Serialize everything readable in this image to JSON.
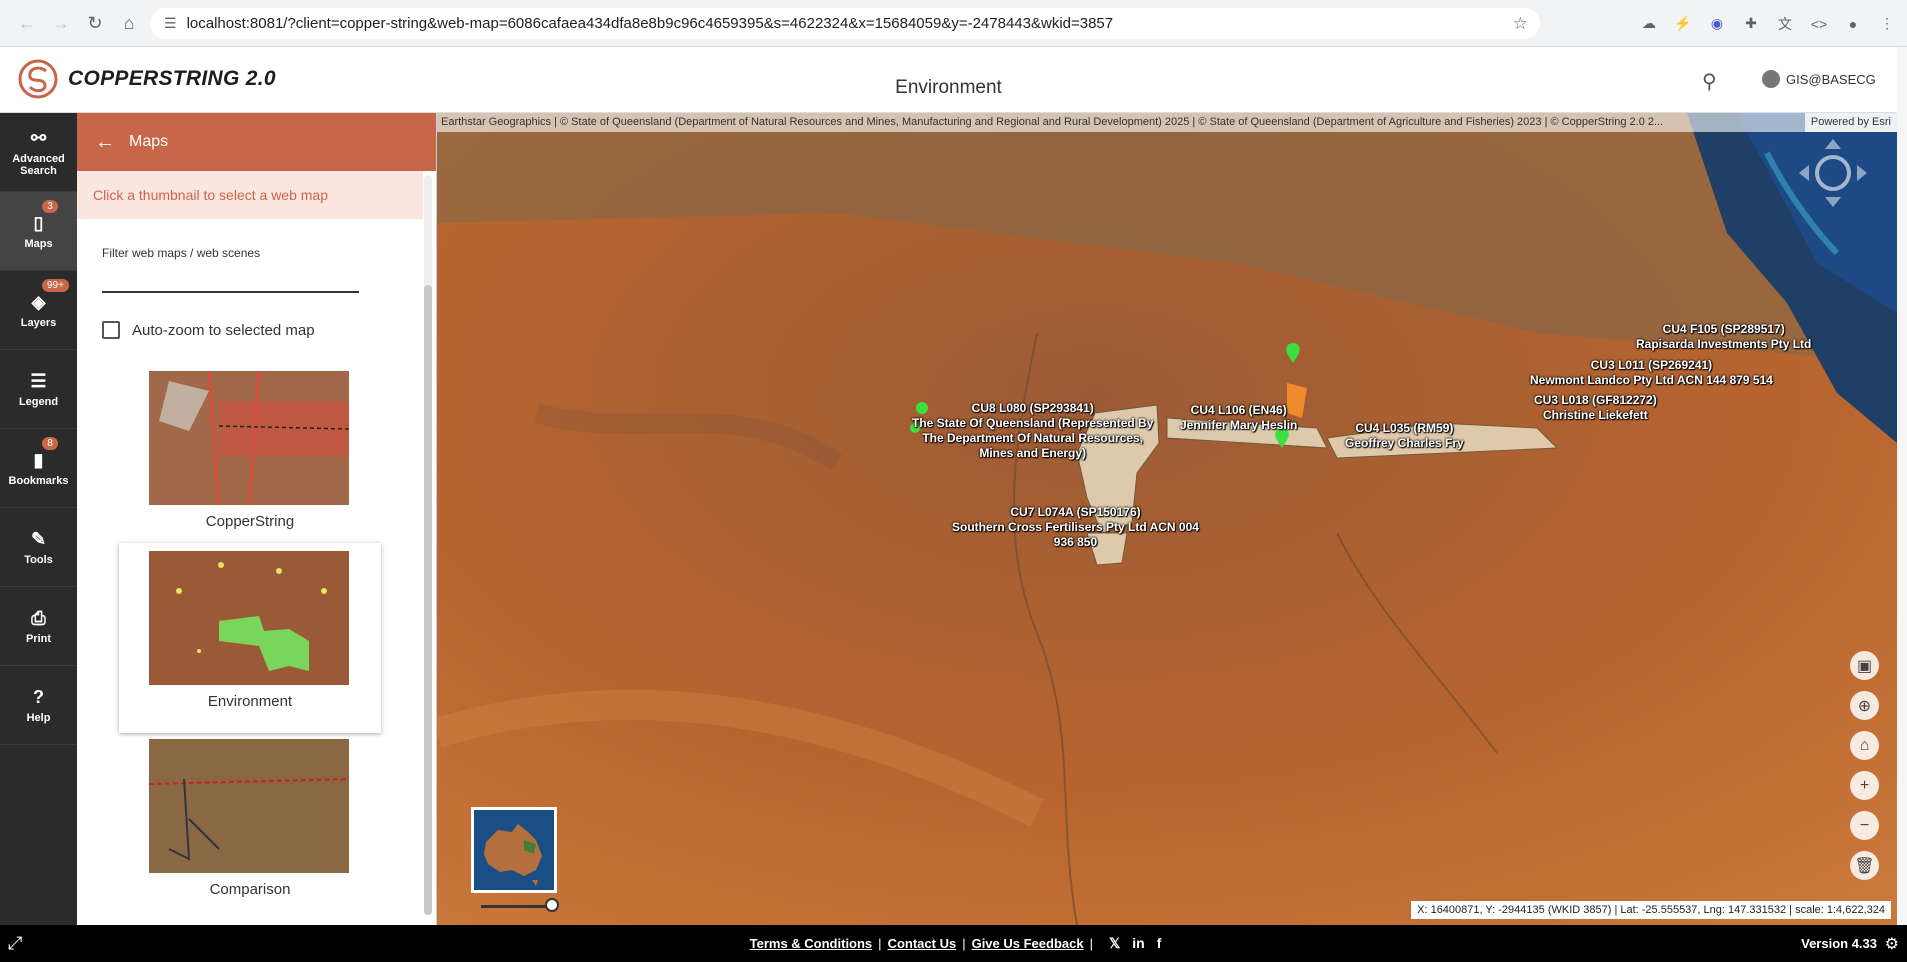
{
  "browser": {
    "url": "localhost:8081/?client=copper-string&web-map=6086cafaea434dfa8e8b9c96c4659395&s=4622324&x=15684059&y=-2478443&wkid=3857"
  },
  "header": {
    "logo_text": "COPPERSTRING 2.0",
    "title": "Environment",
    "user": "GIS@BASECG"
  },
  "rail": {
    "items": [
      {
        "label": "Advanced Search",
        "icon": "binoculars-icon",
        "badge": ""
      },
      {
        "label": "Maps",
        "icon": "map-icon",
        "badge": "3"
      },
      {
        "label": "Layers",
        "icon": "layers-icon",
        "badge": "99+"
      },
      {
        "label": "Legend",
        "icon": "list-icon",
        "badge": ""
      },
      {
        "label": "Bookmarks",
        "icon": "bookmark-icon",
        "badge": "8"
      },
      {
        "label": "Tools",
        "icon": "wrench-icon",
        "badge": ""
      },
      {
        "label": "Print",
        "icon": "printer-icon",
        "badge": ""
      },
      {
        "label": "Help",
        "icon": "help-icon",
        "badge": ""
      }
    ]
  },
  "panel": {
    "title": "Maps",
    "hint": "Click a thumbnail to select a web map",
    "filter_label": "Filter web maps / web scenes",
    "filter_value": "",
    "autozoom_label": "Auto-zoom to selected map",
    "autozoom_checked": false,
    "maps": [
      {
        "label": "CopperString",
        "selected": false
      },
      {
        "label": "Environment",
        "selected": true
      },
      {
        "label": "Comparison",
        "selected": false
      }
    ]
  },
  "map": {
    "attribution": "Earthstar Geographics | © State of Queensland (Department of Natural Resources and Mines, Manufacturing and Regional and Rural Development) 2025 | © State of Queensland (Department of Agriculture and Fisheries) 2023 | © CopperString 2.0 2...",
    "powered_by": "Powered by Esri",
    "labels": {
      "cu8": "CU8 L080 (SP293841)\nThe State Of Queensland (Represented By\nThe Department Of Natural Resources,\nMines and Energy)",
      "cu4_l106": "CU4 L106 (EN46)\nJennifer Mary Heslin",
      "cu4_l035": "CU4 L035 (RM59)\nGeoffrey Charles Fry",
      "cu7": "CU7 L074A (SP150176)\nSouthern Cross Fertilisers Pty Ltd ACN 004\n936 850",
      "cu4_f105": "CU4 F105 (SP289517)\nRapisarda Investments Pty Ltd",
      "cu3_l011": "CU3 L011 (SP269241)\nNewmont Landco Pty Ltd ACN 144 879 514",
      "cu3_l018": "CU3 L018 (GF812272)\nChristine Liekefett"
    },
    "coords": "X: 16400871, Y: -2944135 (WKID 3857) | Lat: -25.555537, Lng: 147.331532 | scale: 1:4,622,324"
  },
  "footer": {
    "terms": "Terms & Conditions",
    "contact": "Contact Us",
    "feedback": "Give Us Feedback",
    "social_x": "𝕏",
    "social_linkedin": "in",
    "social_facebook": "f",
    "version": "Version 4.33"
  },
  "colors": {
    "accent": "#c8664a",
    "rail_bg": "#2b2b2b",
    "footer_bg": "#000000"
  }
}
